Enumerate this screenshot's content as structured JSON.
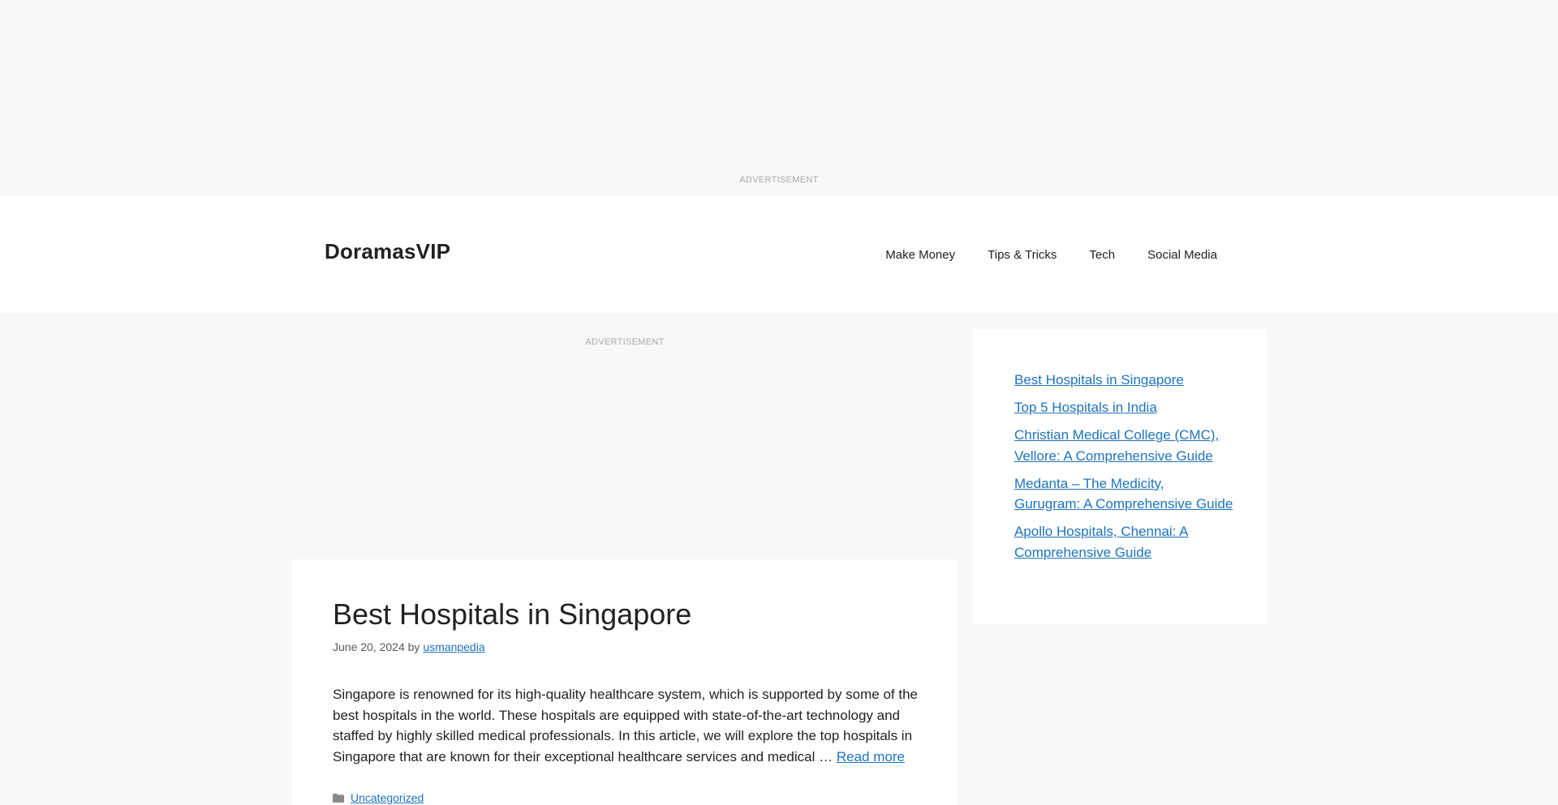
{
  "ads": {
    "top_label": "ADVERTISEMENT",
    "content_label": "ADVERTISEMENT"
  },
  "header": {
    "site_title": "DoramasVIP",
    "nav": [
      "Make Money",
      "Tips & Tricks",
      "Tech",
      "Social Media"
    ]
  },
  "post": {
    "title": "Best Hospitals in Singapore",
    "date": "June 20, 2024",
    "by": "by",
    "author": "usmanpedia",
    "excerpt": "Singapore is renowned for its high-quality healthcare system, which is supported by some of the best hospitals in the world. These hospitals are equipped with state-of-the-art technology and staffed by highly skilled medical professionals. In this article, we will explore the top hospitals in Singapore that are known for their exceptional healthcare services and medical …",
    "read_more": "Read more",
    "category": "Uncategorized"
  },
  "sidebar": {
    "recent_posts": [
      "Best Hospitals in Singapore",
      "Top 5 Hospitals in India",
      "Christian Medical College (CMC), Vellore: A Comprehensive Guide",
      "Medanta – The Medicity, Gurugram: A Comprehensive Guide",
      "Apollo Hospitals, Chennai: A Comprehensive Guide"
    ]
  },
  "colors": {
    "background": "#f7f8f9",
    "surface": "#ffffff",
    "link": "#1e73be",
    "text": "#222222",
    "meta": "#595959",
    "ad_label": "#a9a9a9"
  },
  "icons": {
    "category": "folder-icon"
  }
}
